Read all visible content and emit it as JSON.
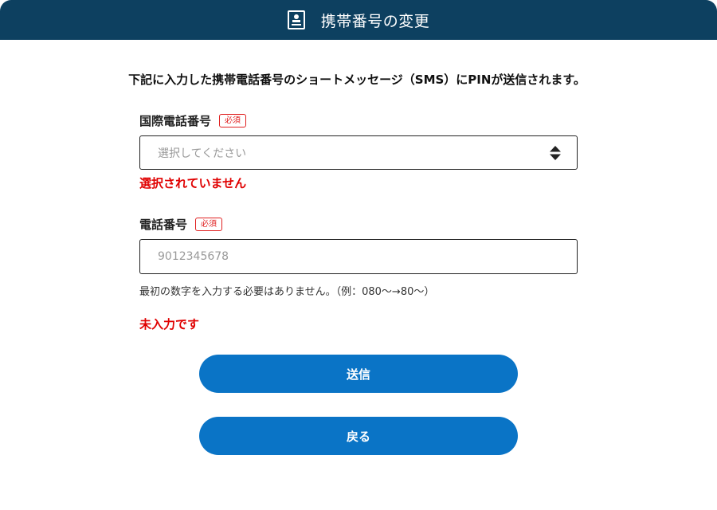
{
  "header": {
    "title": "携帯番号の変更",
    "icon": "id-card-icon",
    "background_color": "#0d4060"
  },
  "lead_text": "下記に入力した携帯電話番号のショートメッセージ（SMS）にPINが送信されます。",
  "country_code": {
    "label": "国際電話番号",
    "required_badge": "必須",
    "placeholder": "選択してください",
    "error": "選択されていません"
  },
  "phone": {
    "label": "電話番号",
    "required_badge": "必須",
    "placeholder": "9012345678",
    "hint": "最初の数字を入力する必要はありません。（例：080～→80～）",
    "error": "未入力です"
  },
  "buttons": {
    "submit_label": "送信",
    "back_label": "戻る",
    "color": "#0a74c6"
  },
  "colors": {
    "error": "#e00000",
    "badge": "#e02020"
  }
}
